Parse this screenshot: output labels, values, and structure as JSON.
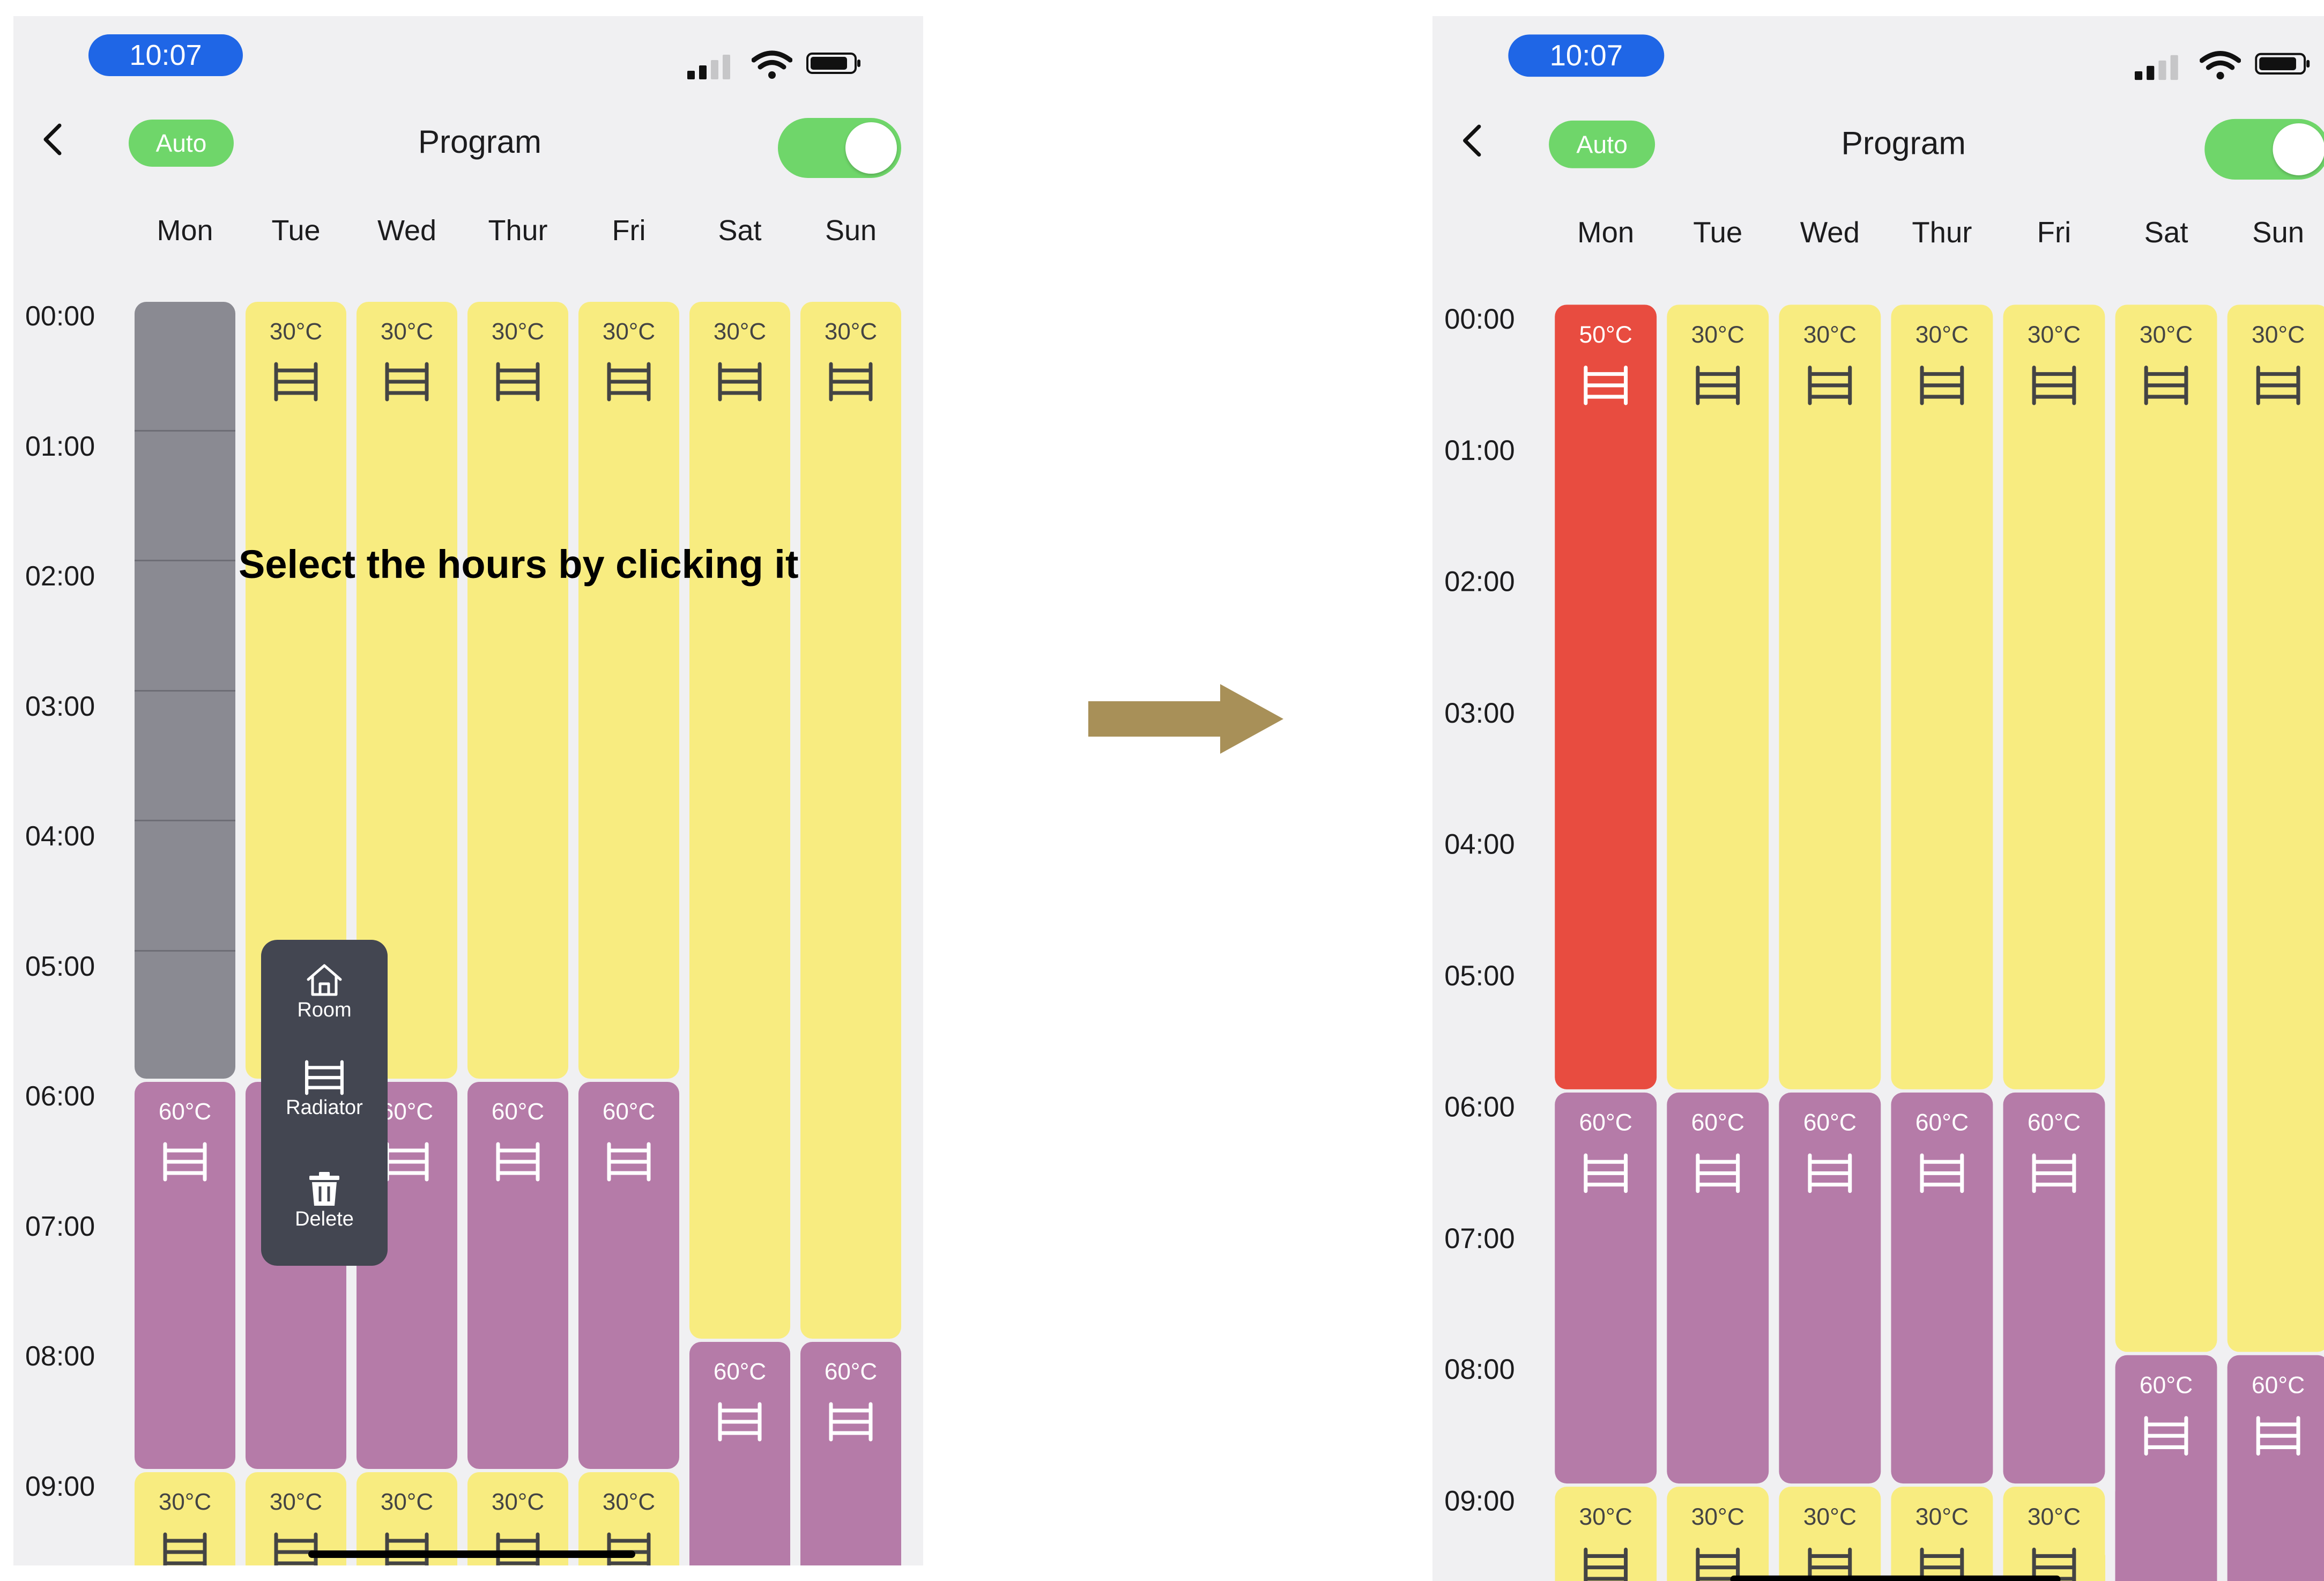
{
  "screens": {
    "before": {
      "status": {
        "time": "10:07"
      },
      "nav": {
        "mode_badge": "Auto",
        "title": "Program",
        "toggle_on": true
      },
      "days": [
        "Mon",
        "Tue",
        "Wed",
        "Thur",
        "Fri",
        "Sat",
        "Sun"
      ],
      "hours": [
        "00:00",
        "01:00",
        "02:00",
        "03:00",
        "04:00",
        "05:00",
        "06:00",
        "07:00",
        "08:00",
        "09:00"
      ],
      "hint": "Select the hours by clicking it",
      "schedule": [
        [
          {
            "start": 0,
            "end": 6,
            "label": "",
            "color": "#8a8a92",
            "icon": "none",
            "state": "selected"
          },
          {
            "start": 6,
            "end": 9,
            "label": "60°C",
            "color": "#b57ba8",
            "icon": "radiator-icon"
          },
          {
            "start": 9,
            "end": 10,
            "label": "30°C",
            "color": "#f8ec80",
            "icon": "radiator-icon"
          }
        ],
        [
          {
            "start": 0,
            "end": 6,
            "label": "30°C",
            "color": "#f8ec80",
            "icon": "radiator-icon"
          },
          {
            "start": 6,
            "end": 9,
            "label": "60°C",
            "color": "#b57ba8",
            "icon": "radiator-icon"
          },
          {
            "start": 9,
            "end": 10,
            "label": "30°C",
            "color": "#f8ec80",
            "icon": "radiator-icon"
          }
        ],
        [
          {
            "start": 0,
            "end": 6,
            "label": "30°C",
            "color": "#f8ec80",
            "icon": "radiator-icon"
          },
          {
            "start": 6,
            "end": 9,
            "label": "60°C",
            "color": "#b57ba8",
            "icon": "radiator-icon"
          },
          {
            "start": 9,
            "end": 10,
            "label": "30°C",
            "color": "#f8ec80",
            "icon": "radiator-icon"
          }
        ],
        [
          {
            "start": 0,
            "end": 6,
            "label": "30°C",
            "color": "#f8ec80",
            "icon": "radiator-icon"
          },
          {
            "start": 6,
            "end": 9,
            "label": "60°C",
            "color": "#b57ba8",
            "icon": "radiator-icon"
          },
          {
            "start": 9,
            "end": 10,
            "label": "30°C",
            "color": "#f8ec80",
            "icon": "radiator-icon"
          }
        ],
        [
          {
            "start": 0,
            "end": 6,
            "label": "30°C",
            "color": "#f8ec80",
            "icon": "radiator-icon"
          },
          {
            "start": 6,
            "end": 9,
            "label": "60°C",
            "color": "#b57ba8",
            "icon": "radiator-icon"
          },
          {
            "start": 9,
            "end": 10,
            "label": "30°C",
            "color": "#f8ec80",
            "icon": "radiator-icon"
          }
        ],
        [
          {
            "start": 0,
            "end": 8,
            "label": "30°C",
            "color": "#f8ec80",
            "icon": "radiator-icon"
          },
          {
            "start": 8,
            "end": 10,
            "label": "60°C",
            "color": "#b57ba8",
            "icon": "radiator-icon"
          }
        ],
        [
          {
            "start": 0,
            "end": 8,
            "label": "30°C",
            "color": "#f8ec80",
            "icon": "radiator-icon"
          },
          {
            "start": 8,
            "end": 10,
            "label": "60°C",
            "color": "#b57ba8",
            "icon": "radiator-icon"
          }
        ]
      ],
      "popup": {
        "items": [
          {
            "label": "Room",
            "icon": "home-icon"
          },
          {
            "label": "Radiator",
            "icon": "radiator-icon"
          },
          {
            "label": "Delete",
            "icon": "trash-icon"
          }
        ]
      }
    },
    "after": {
      "status": {
        "time": "10:07"
      },
      "nav": {
        "mode_badge": "Auto",
        "title": "Program",
        "toggle_on": true
      },
      "days": [
        "Mon",
        "Tue",
        "Wed",
        "Thur",
        "Fri",
        "Sat",
        "Sun"
      ],
      "hours": [
        "00:00",
        "01:00",
        "02:00",
        "03:00",
        "04:00",
        "05:00",
        "06:00",
        "07:00",
        "08:00",
        "09:00"
      ],
      "schedule": [
        [
          {
            "start": 0,
            "end": 6,
            "label": "50°C",
            "color": "#e84c40",
            "icon": "radiator-icon"
          },
          {
            "start": 6,
            "end": 9,
            "label": "60°C",
            "color": "#b57ba8",
            "icon": "radiator-icon"
          },
          {
            "start": 9,
            "end": 10,
            "label": "30°C",
            "color": "#f8ec80",
            "icon": "radiator-icon"
          }
        ],
        [
          {
            "start": 0,
            "end": 6,
            "label": "30°C",
            "color": "#f8ec80",
            "icon": "radiator-icon"
          },
          {
            "start": 6,
            "end": 9,
            "label": "60°C",
            "color": "#b57ba8",
            "icon": "radiator-icon"
          },
          {
            "start": 9,
            "end": 10,
            "label": "30°C",
            "color": "#f8ec80",
            "icon": "radiator-icon"
          }
        ],
        [
          {
            "start": 0,
            "end": 6,
            "label": "30°C",
            "color": "#f8ec80",
            "icon": "radiator-icon"
          },
          {
            "start": 6,
            "end": 9,
            "label": "60°C",
            "color": "#b57ba8",
            "icon": "radiator-icon"
          },
          {
            "start": 9,
            "end": 10,
            "label": "30°C",
            "color": "#f8ec80",
            "icon": "radiator-icon"
          }
        ],
        [
          {
            "start": 0,
            "end": 6,
            "label": "30°C",
            "color": "#f8ec80",
            "icon": "radiator-icon"
          },
          {
            "start": 6,
            "end": 9,
            "label": "60°C",
            "color": "#b57ba8",
            "icon": "radiator-icon"
          },
          {
            "start": 9,
            "end": 10,
            "label": "30°C",
            "color": "#f8ec80",
            "icon": "radiator-icon"
          }
        ],
        [
          {
            "start": 0,
            "end": 6,
            "label": "30°C",
            "color": "#f8ec80",
            "icon": "radiator-icon"
          },
          {
            "start": 6,
            "end": 9,
            "label": "60°C",
            "color": "#b57ba8",
            "icon": "radiator-icon"
          },
          {
            "start": 9,
            "end": 10,
            "label": "30°C",
            "color": "#f8ec80",
            "icon": "radiator-icon"
          }
        ],
        [
          {
            "start": 0,
            "end": 8,
            "label": "30°C",
            "color": "#f8ec80",
            "icon": "radiator-icon"
          },
          {
            "start": 8,
            "end": 10,
            "label": "60°C",
            "color": "#b57ba8",
            "icon": "radiator-icon"
          }
        ],
        [
          {
            "start": 0,
            "end": 8,
            "label": "30°C",
            "color": "#f8ec80",
            "icon": "radiator-icon"
          },
          {
            "start": 8,
            "end": 10,
            "label": "60°C",
            "color": "#b57ba8",
            "icon": "radiator-icon"
          }
        ]
      ]
    }
  },
  "transition_arrow": {
    "color": "#a89058",
    "icon": "right-arrow-icon"
  },
  "colors": {
    "accent_green": "#6fd66a",
    "time_pill": "#1f66e6",
    "popup_bg": "#434651"
  }
}
